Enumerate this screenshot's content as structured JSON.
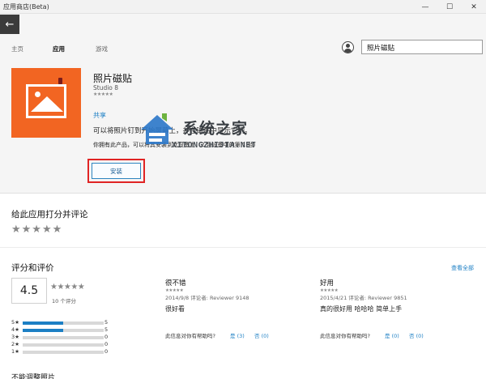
{
  "window": {
    "title": "应用商店(Beta)",
    "min": "—",
    "max": "☐",
    "close": "✕"
  },
  "nav": {
    "back": "←",
    "tabs": [
      "主页",
      "应用",
      "游戏"
    ],
    "active_tab": "应用",
    "search_value": "照片磁贴"
  },
  "app": {
    "name": "照片磁贴",
    "publisher": "Studio 8",
    "stars": "★★★★★",
    "share": "共享",
    "description": "可以将照片钉到开始屏幕上，并在磁贴中显示它们。",
    "ownership": "你拥有此产品，可以将其安装到此设备上（2 台设备中的第 1 台）",
    "install_label": "安装",
    "accent": "#f26522"
  },
  "watermark": {
    "cn": "系统之家",
    "en": "XITONGZHIJIA.NET"
  },
  "rate": {
    "heading": "给此应用打分并评论",
    "stars": "★★★★★"
  },
  "ratings": {
    "heading": "评分和评价",
    "see_all": "查看全部",
    "score": "4.5",
    "avg_stars": "★★★★★",
    "count": "10 个评分",
    "distribution": [
      {
        "label": "5★",
        "count": "5",
        "fraction": 0.5
      },
      {
        "label": "4★",
        "count": "5",
        "fraction": 0.5
      },
      {
        "label": "3★",
        "count": "0",
        "fraction": 0
      },
      {
        "label": "2★",
        "count": "0",
        "fraction": 0
      },
      {
        "label": "1★",
        "count": "0",
        "fraction": 0
      }
    ]
  },
  "reviews": [
    {
      "title": "很不错",
      "stars": "★★★★★",
      "meta": "2014/9/8 评论者: Reviewer 9148",
      "body": "很好看",
      "helpful_q": "此信息对你有帮助吗?",
      "yes": "是 (3)",
      "no": "否 (0)"
    },
    {
      "title": "好用",
      "stars": "★★★★★",
      "meta": "2015/4/21 评论者: Reviewer 9851",
      "body": "真的很好用 哈哈哈  简单上手",
      "helpful_q": "此信息对你有帮助吗?",
      "yes": "是 (0)",
      "no": "否 (0)"
    }
  ],
  "bottom_heading": "不能调整照片"
}
